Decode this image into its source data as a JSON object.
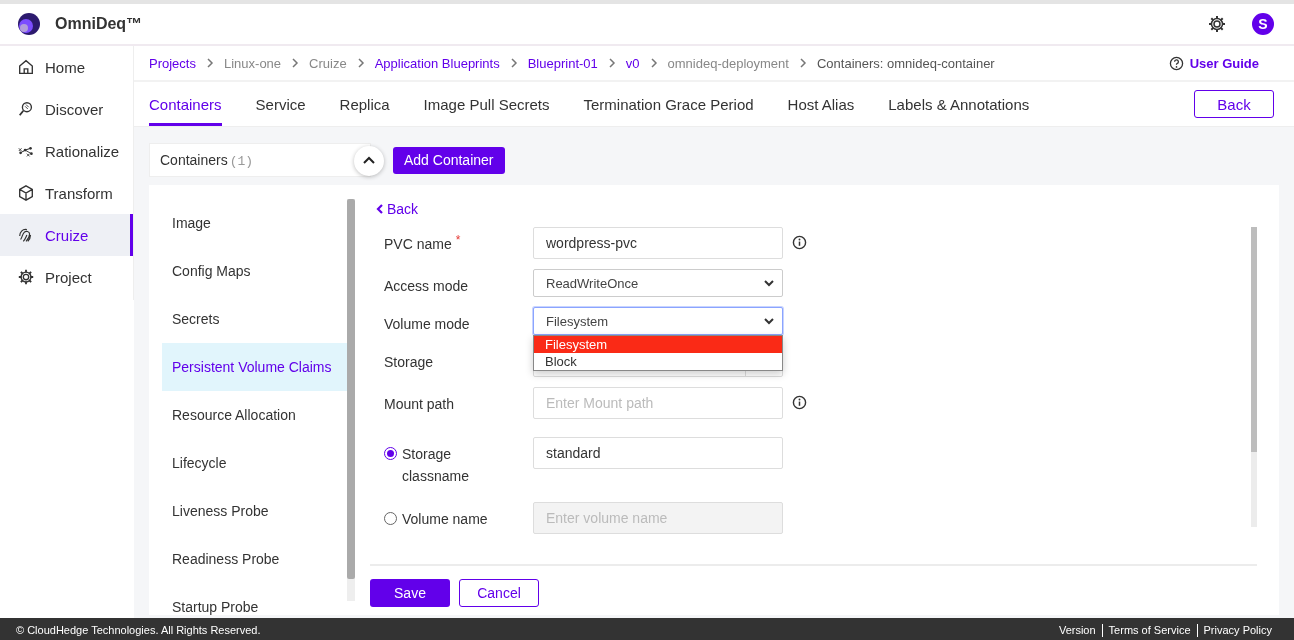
{
  "header": {
    "brand": "OmniDeq™",
    "avatar": "S"
  },
  "sidebar": {
    "items": [
      {
        "label": "Home",
        "selected": false
      },
      {
        "label": "Discover",
        "selected": false
      },
      {
        "label": "Rationalize",
        "selected": false
      },
      {
        "label": "Transform",
        "selected": false
      },
      {
        "label": "Cruize",
        "selected": true
      },
      {
        "label": "Project",
        "selected": false
      }
    ]
  },
  "breadcrumb": [
    {
      "label": "Projects",
      "link": true
    },
    {
      "label": "Linux-one",
      "link": false
    },
    {
      "label": "Cruize",
      "link": false
    },
    {
      "label": "Application Blueprints",
      "link": true
    },
    {
      "label": "Blueprint-01",
      "link": true
    },
    {
      "label": "v0",
      "link": true
    },
    {
      "label": "omnideq-deployment",
      "link": false
    },
    {
      "label": "Containers: omnideq-container",
      "link": false,
      "current": true
    }
  ],
  "user_guide": "User Guide",
  "tabs": [
    {
      "label": "Containers",
      "selected": true
    },
    {
      "label": "Service",
      "selected": false
    },
    {
      "label": "Replica",
      "selected": false
    },
    {
      "label": "Image Pull Secrets",
      "selected": false
    },
    {
      "label": "Termination Grace Period",
      "selected": false
    },
    {
      "label": "Host Alias",
      "selected": false
    },
    {
      "label": "Labels & Annotations",
      "selected": false
    }
  ],
  "back_button": "Back",
  "containers_panel": {
    "label": "Containers",
    "count": "(1)",
    "expanded": true
  },
  "add_container": "Add Container",
  "sections": [
    {
      "label": "Image",
      "selected": false
    },
    {
      "label": "Config Maps",
      "selected": false
    },
    {
      "label": "Secrets",
      "selected": false
    },
    {
      "label": "Persistent Volume Claims",
      "selected": true
    },
    {
      "label": "Resource Allocation",
      "selected": false
    },
    {
      "label": "Lifecycle",
      "selected": false
    },
    {
      "label": "Liveness Probe",
      "selected": false
    },
    {
      "label": "Readiness Probe",
      "selected": false
    },
    {
      "label": "Startup Probe",
      "selected": false
    }
  ],
  "form": {
    "back_link": "Back",
    "fields": [
      {
        "kind": "text",
        "label": "PVC name",
        "required_mark": "*",
        "info": true,
        "value": "wordpress-pvc"
      },
      {
        "kind": "select",
        "label": "Access mode",
        "info": false,
        "value": "ReadWriteOnce",
        "expanded": false
      },
      {
        "kind": "select",
        "label": "Volume mode",
        "info": false,
        "value": "Filesystem",
        "expanded": true,
        "options": [
          {
            "label": "Filesystem",
            "selected": true
          },
          {
            "label": "Block",
            "selected": false
          }
        ]
      },
      {
        "kind": "quantity",
        "label": "Storage",
        "info": false
      },
      {
        "kind": "text",
        "label": "Mount path",
        "info": true,
        "placeholder": "Enter Mount path"
      },
      {
        "kind": "radio",
        "label": "Storage classname",
        "info": false,
        "selected": true,
        "value": "standard",
        "disabled": false
      },
      {
        "kind": "radio",
        "label": "Volume name",
        "info": false,
        "selected": false,
        "placeholder": "Enter volume name",
        "disabled": true
      }
    ]
  },
  "actions": {
    "save": "Save",
    "cancel": "Cancel"
  },
  "footer": {
    "copyright": "© CloudHedge Technologies. All Rights Reserved.",
    "links": [
      "Version",
      "Terms of Service",
      "Privacy Policy"
    ]
  }
}
